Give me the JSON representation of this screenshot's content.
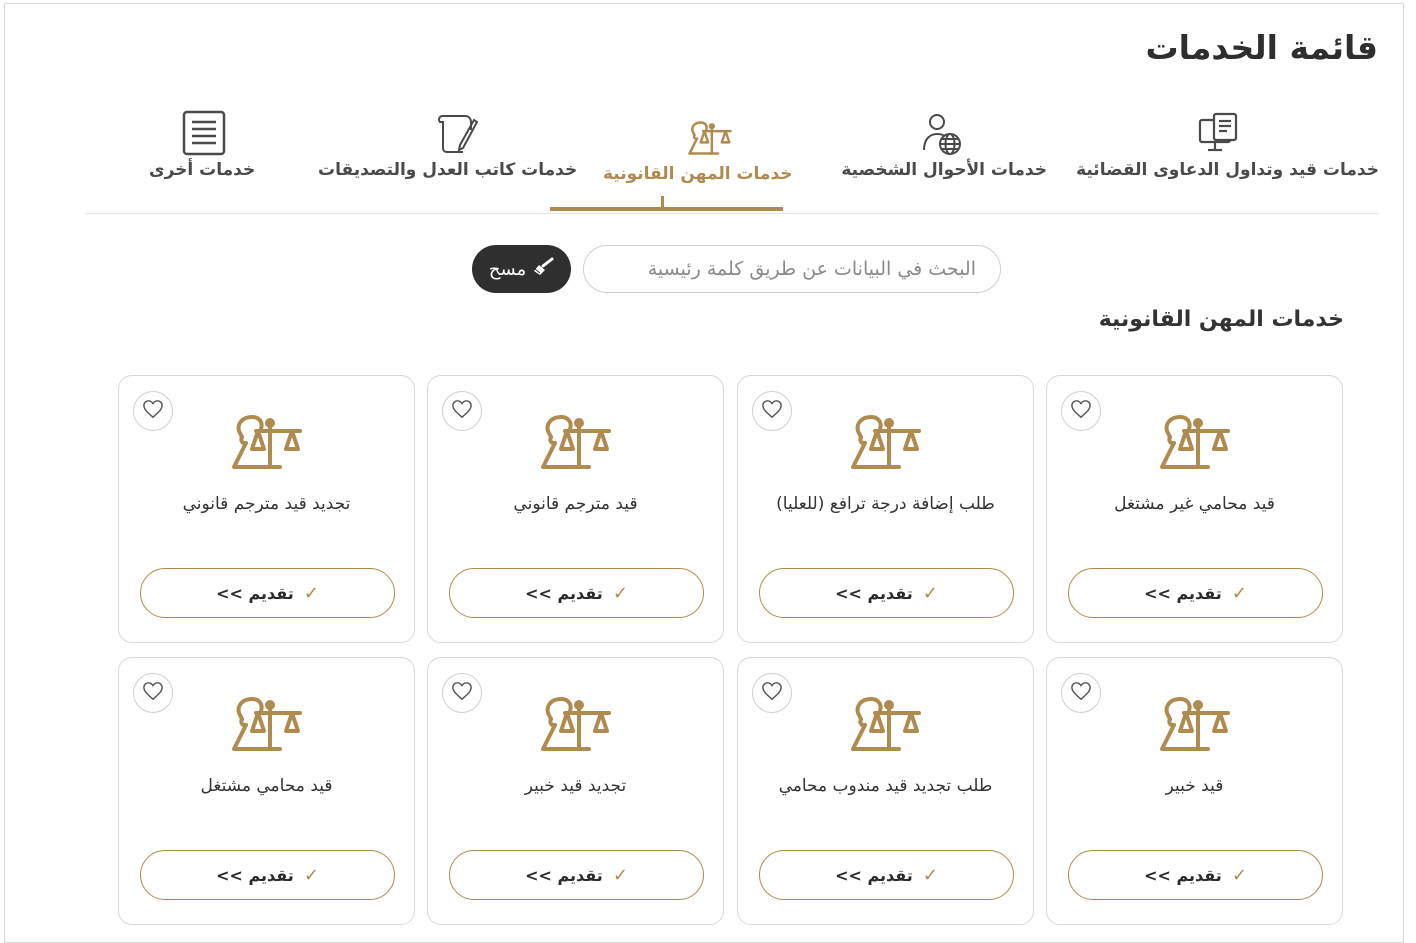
{
  "page": {
    "title": "قائمة الخدمات"
  },
  "tabs": [
    {
      "label": "خدمات قيد وتداول الدعاوى القضائية",
      "icon": "computer-document-icon"
    },
    {
      "label": "خدمات الأحوال الشخصية",
      "icon": "person-globe-icon"
    },
    {
      "label": "خدمات المهن القانونية",
      "icon": "lawyer-scales-icon",
      "active": true
    },
    {
      "label": "خدمات كاتب العدل والتصديقات",
      "icon": "scroll-pen-icon"
    },
    {
      "label": "خدمات أخرى",
      "icon": "document-list-icon"
    }
  ],
  "search": {
    "placeholder": "البحث في البيانات عن طريق كلمة رئيسية"
  },
  "clear_button": {
    "label": "مسح",
    "icon": "broom-icon"
  },
  "section": {
    "title": "خدمات المهن القانونية"
  },
  "apply_label": "تقديم >>",
  "cards": [
    {
      "title": "قيد محامي غير مشتغل"
    },
    {
      "title": "طلب إضافة درجة ترافع (للعليا)"
    },
    {
      "title": "قيد مترجم قانوني"
    },
    {
      "title": "تجديد قيد مترجم قانوني"
    },
    {
      "title": "قيد خبير"
    },
    {
      "title": "طلب تجديد قيد مندوب محامي"
    },
    {
      "title": "تجديد قيد خبير"
    },
    {
      "title": "قيد محامي مشتغل"
    }
  ],
  "colors": {
    "accent": "#b08b4f",
    "dark_button": "#2f2f2f",
    "border": "#d8d8d8"
  }
}
